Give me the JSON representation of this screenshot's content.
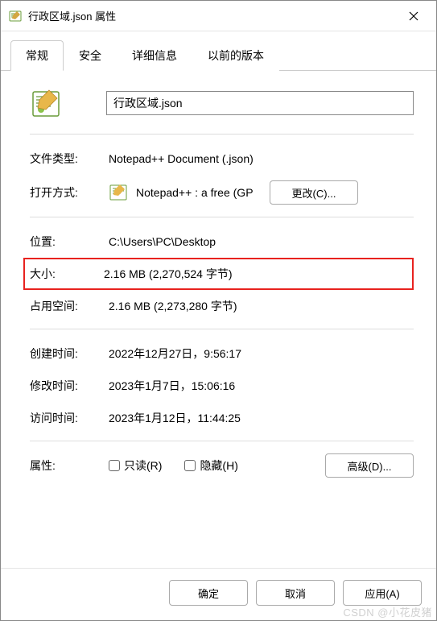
{
  "titlebar": {
    "title": "行政区域.json 属性"
  },
  "tabs": {
    "items": [
      {
        "label": "常规"
      },
      {
        "label": "安全"
      },
      {
        "label": "详细信息"
      },
      {
        "label": "以前的版本"
      }
    ]
  },
  "file": {
    "name": "行政区域.json"
  },
  "props": {
    "type_label": "文件类型:",
    "type_value": "Notepad++ Document (.json)",
    "open_label": "打开方式:",
    "open_value": "Notepad++ : a free (GP",
    "change_btn": "更改(C)...",
    "location_label": "位置:",
    "location_value": "C:\\Users\\PC\\Desktop",
    "size_label": "大小:",
    "size_value": "2.16 MB (2,270,524 字节)",
    "disk_label": "占用空间:",
    "disk_value": "2.16 MB (2,273,280 字节)",
    "created_label": "创建时间:",
    "created_value": "2022年12月27日，9:56:17",
    "modified_label": "修改时间:",
    "modified_value": "2023年1月7日，15:06:16",
    "accessed_label": "访问时间:",
    "accessed_value": "2023年1月12日，11:44:25",
    "attr_label": "属性:",
    "readonly_label": "只读(R)",
    "hidden_label": "隐藏(H)",
    "advanced_btn": "高级(D)..."
  },
  "footer": {
    "ok": "确定",
    "cancel": "取消",
    "apply": "应用(A)"
  },
  "watermark": "CSDN @小花皮猪"
}
